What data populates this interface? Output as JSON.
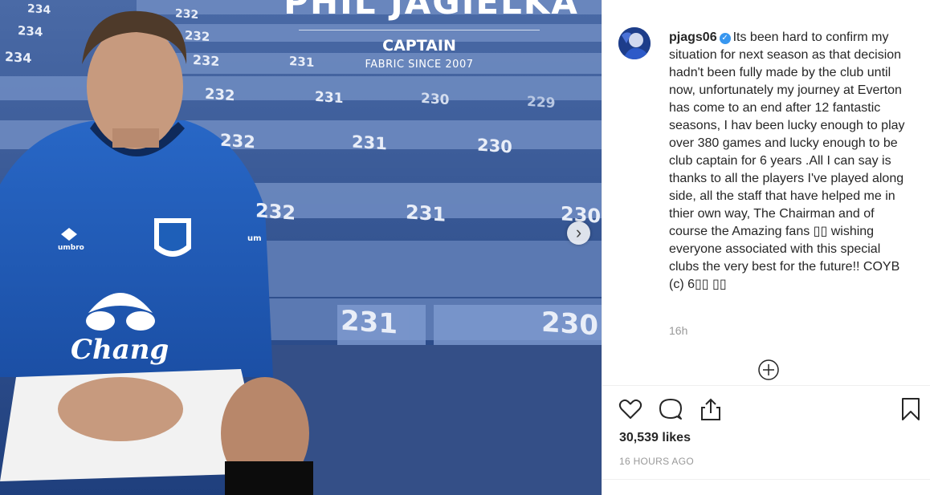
{
  "post_image": {
    "banner": {
      "name": "PHIL JAGIELKA",
      "role": "CAPTAIN",
      "subtitle": "FABRIC SINCE 2007"
    },
    "jersey": {
      "brand": "Chang",
      "kit_maker": "umbro"
    },
    "seat_numbers": [
      "234",
      "232",
      "231",
      "230",
      "229"
    ],
    "next_icon": "chevron-right-icon"
  },
  "post": {
    "username": "pjags06",
    "verified": true,
    "caption": "Its been hard to confirm my situation for next season as that decision hadn't been fully made by the club until now, unfortunately my journey at Everton has come to an end after 12 fantastic seasons, I hav been lucky enough to play over 380 games and lucky enough to be club captain for 6 years .All I can say is thanks to all the players I've played along side, all the staff that have helped me in thier own way, The Chairman and of course the Amazing fans ▯▯ wishing everyone associated with this special clubs the very best for the future!! COYB (c) 6▯▯ ▯▯",
    "relative_time": "16h",
    "likes": "30,539 likes",
    "timestamp": "16 HOURS AGO"
  },
  "actions": {
    "like_icon": "heart-icon",
    "comment_icon": "comment-icon",
    "share_icon": "share-icon",
    "save_icon": "bookmark-icon",
    "load_more_icon": "plus-circle-icon"
  },
  "colors": {
    "everton_blue": "#1e5fb8",
    "verified_blue": "#3897f0",
    "muted_text": "#999999",
    "text": "#262626"
  }
}
